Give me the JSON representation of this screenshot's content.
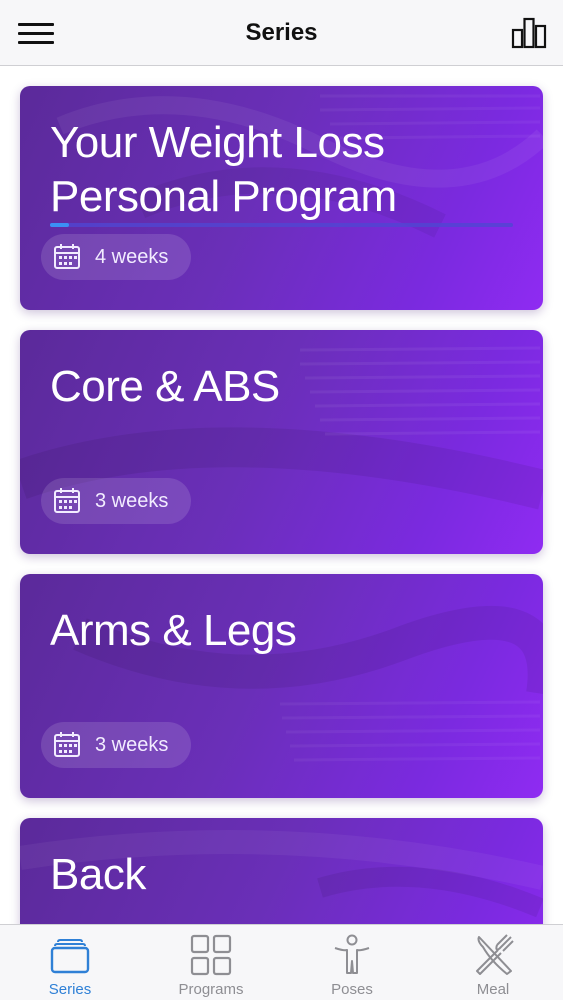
{
  "header": {
    "title": "Series",
    "menu_icon": "hamburger-menu-icon",
    "stats_icon": "bar-chart-icon"
  },
  "series": [
    {
      "title": "Your Weight Loss Personal Program",
      "duration": "4 weeks",
      "progress": 0.04
    },
    {
      "title": "Core & ABS",
      "duration": "3 weeks"
    },
    {
      "title": "Arms & Legs",
      "duration": "3 weeks"
    },
    {
      "title": "Back"
    }
  ],
  "tabs": [
    {
      "label": "Series",
      "icon": "series-stack-icon",
      "active": true
    },
    {
      "label": "Programs",
      "icon": "grid-icon",
      "active": false
    },
    {
      "label": "Poses",
      "icon": "person-pose-icon",
      "active": false
    },
    {
      "label": "Meal",
      "icon": "fork-knife-icon",
      "active": false
    }
  ],
  "colors": {
    "accent": "#2f80d6",
    "inactive": "#8e8e93",
    "card_start": "#5b2a9a",
    "card_end": "#8f2bf2",
    "progress": "#3b8ff5"
  }
}
